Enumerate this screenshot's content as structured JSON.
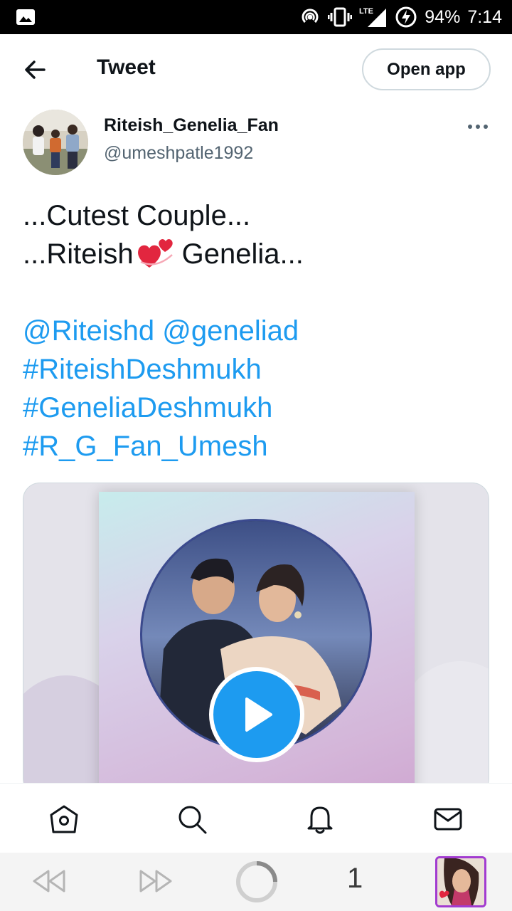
{
  "status_bar": {
    "battery": "94%",
    "time": "7:14",
    "network": "LTE",
    "icons": [
      "gallery-icon",
      "hotspot-icon",
      "vibrate-icon",
      "signal-icon",
      "battery-saver-icon"
    ]
  },
  "header": {
    "title": "Tweet",
    "open_app_label": "Open app",
    "back_icon": "arrow-left-icon"
  },
  "author": {
    "name": "Riteish_Genelia_Fan",
    "handle": "@umeshpatle1992"
  },
  "tweet": {
    "line1": "...Cutest Couple...",
    "line2_before": "...Riteish",
    "line2_after": "Genelia...",
    "emoji": "revolving-hearts-emoji",
    "mention1": "@Riteishd",
    "mention2": "@geneliad",
    "hashtag1": "#RiteishDeshmukh",
    "hashtag2": "#GeneliaDeshmukh",
    "hashtag3": "#R_G_Fan_Umesh"
  },
  "media": {
    "type": "video",
    "play_icon": "play-icon"
  },
  "bottom_nav": {
    "items": [
      "home-icon",
      "search-icon",
      "notifications-icon",
      "messages-icon"
    ]
  },
  "browser_bar": {
    "tab_count": "1",
    "icons": [
      "back-icon",
      "forward-icon",
      "loading-icon",
      "tab-thumbnail"
    ]
  },
  "colors": {
    "link": "#1d9bf0",
    "text": "#0f1419",
    "secondary": "#536471",
    "play": "#1d9bf0"
  }
}
